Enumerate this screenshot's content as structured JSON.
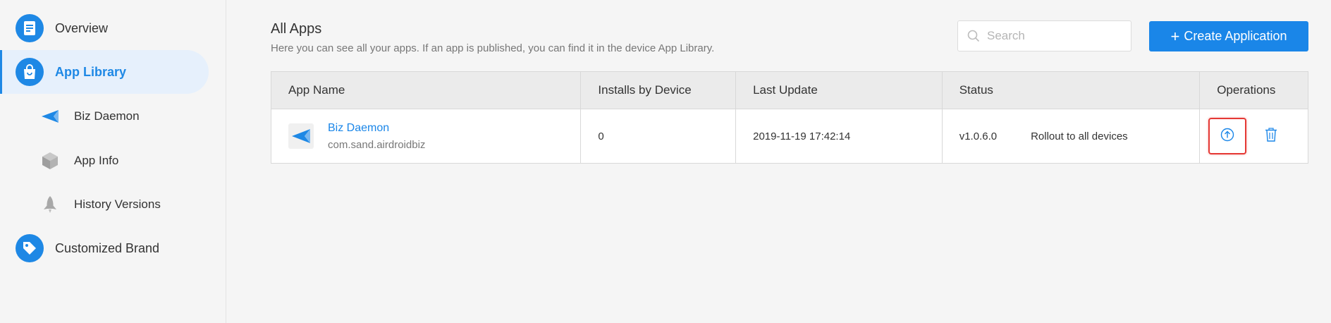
{
  "sidebar": {
    "overview": "Overview",
    "app_library": "App Library",
    "biz_daemon": "Biz Daemon",
    "app_info": "App Info",
    "history_versions": "History Versions",
    "customized_brand": "Customized Brand"
  },
  "header": {
    "title": "All Apps",
    "description": "Here you can see all your apps. If an app is published, you can find it in the device App Library.",
    "search_placeholder": "Search",
    "create_button": "Create Application"
  },
  "table": {
    "columns": [
      "App Name",
      "Installs by Device",
      "Last Update",
      "Status",
      "Operations"
    ],
    "rows": [
      {
        "app_name": "Biz Daemon",
        "package": "com.sand.airdroidbiz",
        "installs": "0",
        "last_update": "2019-11-19 17:42:14",
        "version": "v1.0.6.0",
        "status": "Rollout to all devices"
      }
    ]
  },
  "colors": {
    "accent": "#1a86e8",
    "active_bg": "#e6f0fc",
    "highlight": "#e53935"
  }
}
